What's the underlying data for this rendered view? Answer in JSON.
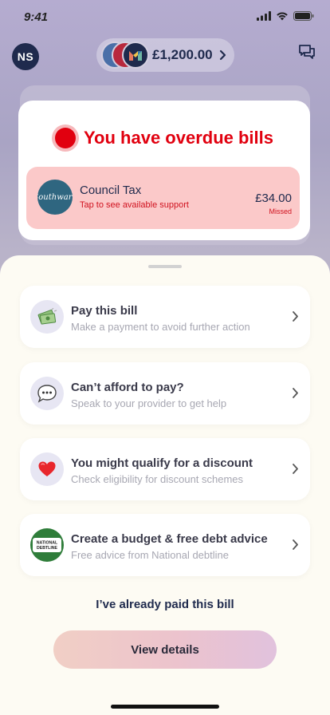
{
  "status_bar": {
    "time": "9:41"
  },
  "header": {
    "avatar_initials": "NS",
    "balance": "£1,200.00",
    "icons": [
      "chevron-right-icon",
      "chat-icon"
    ]
  },
  "overdue": {
    "title": "You have overdue bills",
    "bill": {
      "provider_logo_text": "Southwark",
      "name": "Council Tax",
      "subtitle": "Tap to see available support",
      "amount": "£34.00",
      "status": "Missed"
    }
  },
  "options": [
    {
      "title": "Pay this bill",
      "subtitle": "Make a payment to avoid further action",
      "icon": "money-icon"
    },
    {
      "title": "Can’t afford to pay?",
      "subtitle": "Speak to your provider to get help",
      "icon": "speech-bubble-icon"
    },
    {
      "title": "You might qualify for a discount",
      "subtitle": "Check eligibility for discount schemes",
      "icon": "heart-icon"
    },
    {
      "title": "Create a budget & free debt advice",
      "subtitle": "Free advice from National debtline",
      "icon": "national-debtline-logo",
      "logo_text": "NATIONAL DEBTLINE"
    }
  ],
  "paid_link": "I’ve already paid this bill",
  "view_button": "View details",
  "colors": {
    "accent_red": "#e1000f",
    "navy": "#1f2a4d",
    "bill_row_bg": "#fbc9c9",
    "sheet_bg": "#fdfbf3"
  }
}
